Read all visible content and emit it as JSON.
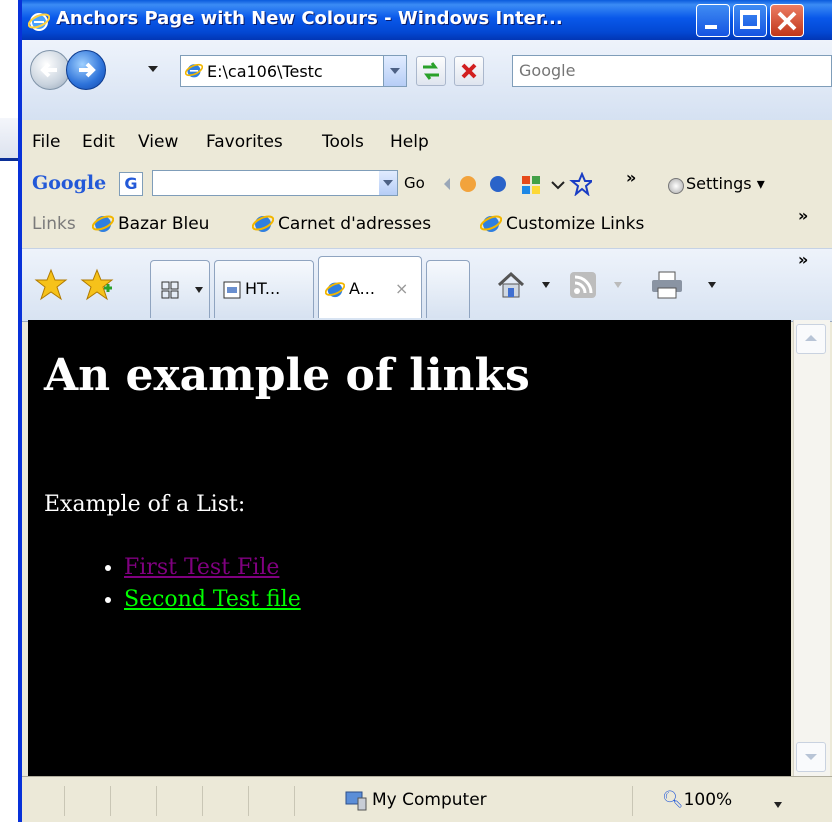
{
  "window": {
    "title": "Anchors Page with New Colours - Windows Inter...",
    "title_bar_color": "#0a5bdc"
  },
  "toolbar": {
    "address_value": "E:\\ca106\\Testc",
    "search_placeholder": "Google"
  },
  "menu": [
    "File",
    "Edit",
    "View",
    "Favorites",
    "Tools",
    "Help"
  ],
  "google_bar": {
    "logo": "Google",
    "go_label": "Go",
    "settings_label": "Settings"
  },
  "links_bar": {
    "label": "Links",
    "items": [
      "Bazar Bleu",
      "Carnet d'adresses",
      "Customize Links"
    ]
  },
  "tabs": [
    {
      "label": "HT..."
    },
    {
      "label": "A..."
    }
  ],
  "page": {
    "heading": "An example of links",
    "intro": "Example of a List:",
    "links": [
      "First Test File",
      "Second Test file"
    ],
    "background_color": "#000000",
    "text_color": "#ffffff",
    "visited_link_color": "#800080",
    "link_color": "#00ff00"
  },
  "status": {
    "zone": "My Computer",
    "zoom": "100%"
  }
}
